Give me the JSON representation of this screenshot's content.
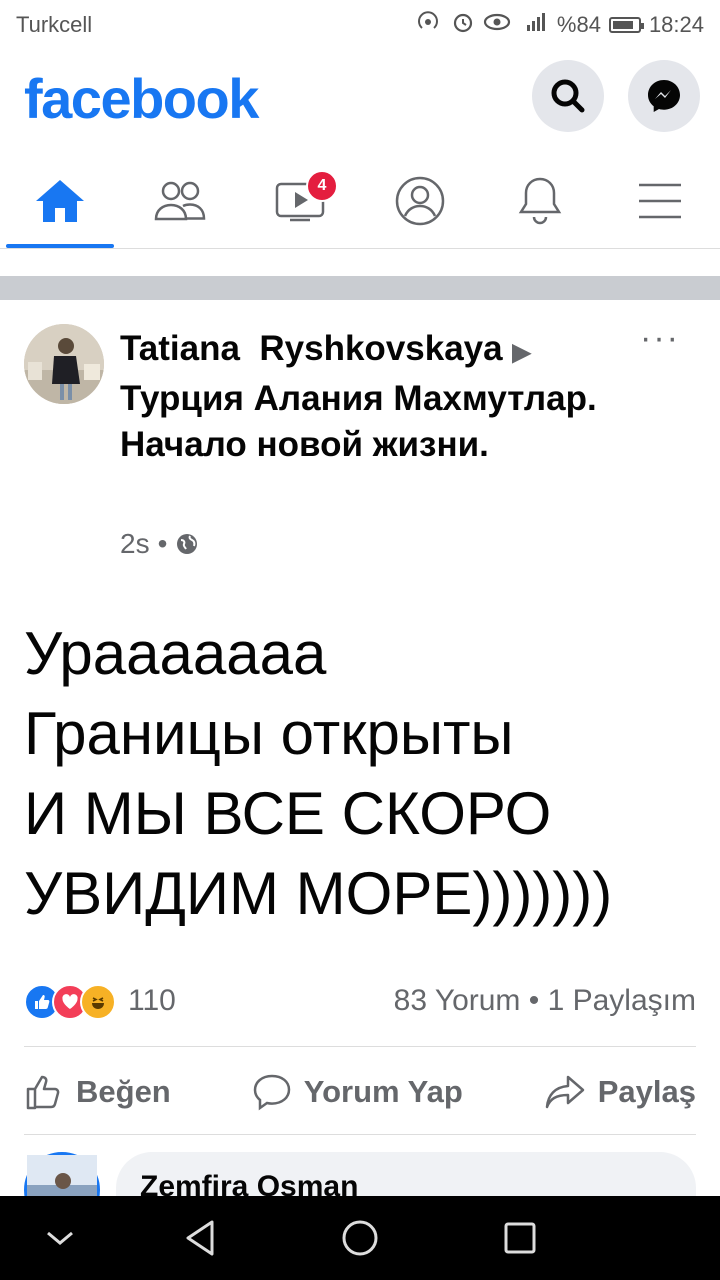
{
  "status": {
    "carrier": "Turkcell",
    "battery": "%84",
    "time": "18:24",
    "icons": [
      "hotspot-icon",
      "alarm-icon",
      "eye-icon",
      "signal-icon"
    ]
  },
  "header": {
    "logo": "facebook",
    "search_icon": "search-icon",
    "messenger_icon": "messenger-icon"
  },
  "nav": {
    "tabs": [
      {
        "name": "home",
        "icon": "home-icon",
        "active": true
      },
      {
        "name": "friends",
        "icon": "friends-icon"
      },
      {
        "name": "watch",
        "icon": "watch-icon",
        "badge": "4"
      },
      {
        "name": "profile",
        "icon": "profile-icon"
      },
      {
        "name": "notifications",
        "icon": "bell-icon"
      },
      {
        "name": "menu",
        "icon": "hamburger-icon"
      }
    ],
    "watch_badge": "4"
  },
  "post": {
    "author": "Tatiana  Ryshkovskaya",
    "group": "Турция Алания Махмутлар. Начало новой жизни.",
    "time": "2s",
    "privacy_icon": "globe-icon",
    "more": "···",
    "text": "Урааааааа\nГраницы открыты\nИ МЫ ВСЕ СКОРО\nУВИДИМ МОРЕ)))))))",
    "reaction_count": "110",
    "reactions": [
      "like",
      "love",
      "haha"
    ],
    "engagement": "83 Yorum • 1 Paylaşım",
    "actions": {
      "like": "Beğen",
      "comment": "Yorum Yap",
      "share": "Paylaş"
    }
  },
  "comment": {
    "author": "Zemfira Osman"
  },
  "colors": {
    "brand": "#1877f2",
    "badge": "#e41e3f",
    "secondary_text": "#65676b"
  }
}
